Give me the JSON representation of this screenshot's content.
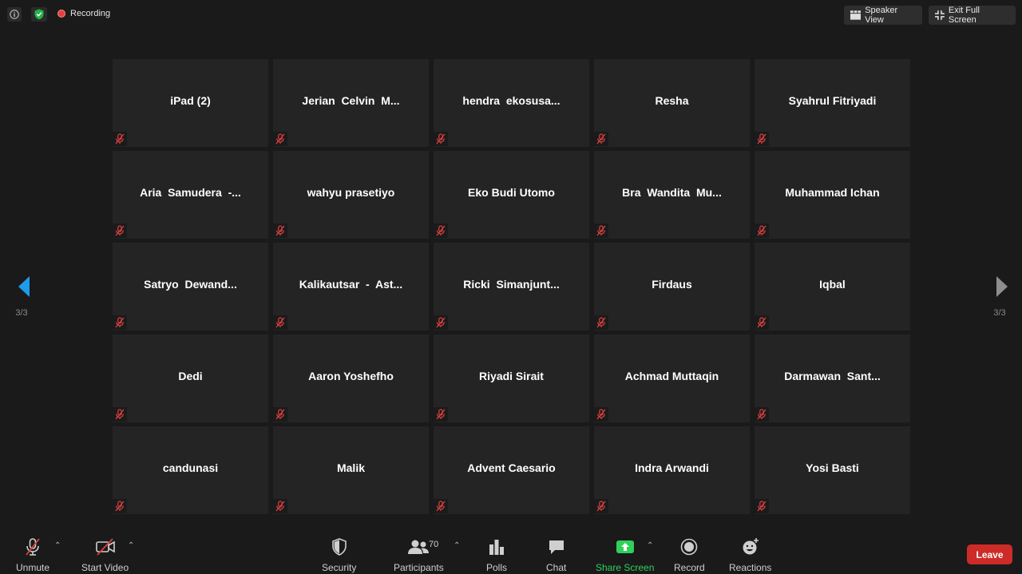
{
  "topbar": {
    "recording_label": "Recording",
    "speaker_view_label": "Speaker View",
    "exit_fullscreen_label": "Exit Full Screen"
  },
  "participants": [
    {
      "name": "iPad (2)"
    },
    {
      "name": "Jerian  Celvin  M..."
    },
    {
      "name": "hendra  ekosusa..."
    },
    {
      "name": "Resha"
    },
    {
      "name": "Syahrul Fitriyadi"
    },
    {
      "name": "Aria  Samudera  -..."
    },
    {
      "name": "wahyu prasetiyo"
    },
    {
      "name": "Eko Budi Utomo"
    },
    {
      "name": "Bra  Wandita  Mu..."
    },
    {
      "name": "Muhammad Ichan"
    },
    {
      "name": "Satryo  Dewand..."
    },
    {
      "name": "Kalikautsar  -  Ast..."
    },
    {
      "name": "Ricki  Simanjunt..."
    },
    {
      "name": "Firdaus"
    },
    {
      "name": "Iqbal"
    },
    {
      "name": "Dedi"
    },
    {
      "name": "Aaron Yoshefho"
    },
    {
      "name": "Riyadi Sirait"
    },
    {
      "name": "Achmad Muttaqin"
    },
    {
      "name": "Darmawan  Sant..."
    },
    {
      "name": "candunasi"
    },
    {
      "name": "Malik"
    },
    {
      "name": "Advent Caesario"
    },
    {
      "name": "Indra Arwandi"
    },
    {
      "name": "Yosi Basti"
    }
  ],
  "pagination": {
    "left_label": "3/3",
    "right_label": "3/3"
  },
  "toolbar": {
    "unmute_label": "Unmute",
    "start_video_label": "Start Video",
    "security_label": "Security",
    "participants_label": "Participants",
    "participants_count": "70",
    "polls_label": "Polls",
    "chat_label": "Chat",
    "share_screen_label": "Share Screen",
    "record_label": "Record",
    "reactions_label": "Reactions",
    "leave_label": "Leave"
  },
  "colors": {
    "accent_blue": "#1e9be9",
    "share_green": "#2fd15a",
    "leave_red": "#cd2b27",
    "mute_red": "#e0413f"
  }
}
